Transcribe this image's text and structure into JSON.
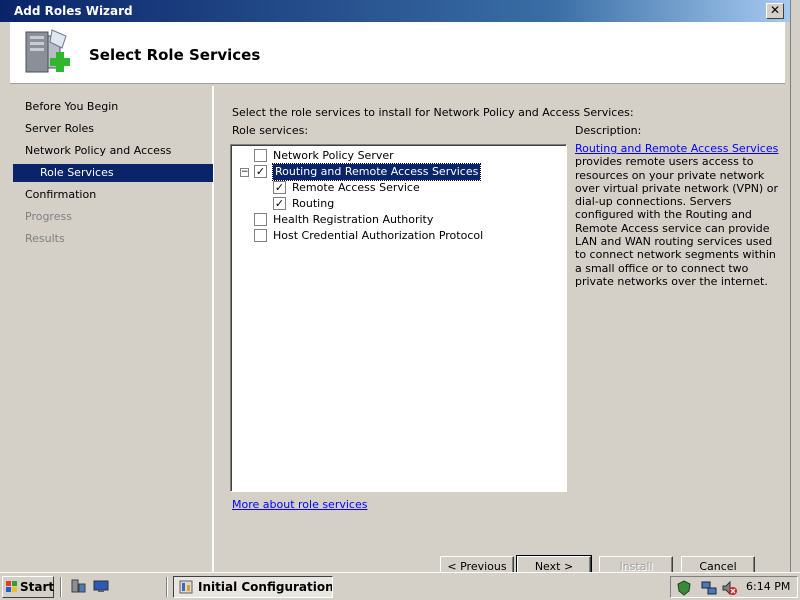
{
  "window": {
    "title": "Add Roles Wizard",
    "close_glyph": "✕",
    "header_title": "Select Role Services"
  },
  "nav": {
    "items": [
      {
        "label": "Before You Begin",
        "state": "normal"
      },
      {
        "label": "Server Roles",
        "state": "normal"
      },
      {
        "label": "Network Policy and Access Services",
        "state": "normal"
      },
      {
        "label": "Role Services",
        "state": "selected"
      },
      {
        "label": "Confirmation",
        "state": "normal"
      },
      {
        "label": "Progress",
        "state": "disabled"
      },
      {
        "label": "Results",
        "state": "disabled"
      }
    ]
  },
  "main": {
    "instruction": "Select the role services to install for Network Policy and Access Services:",
    "role_services_label": "Role services:",
    "description_label": "Description:",
    "description_link": "Routing and Remote Access Services",
    "description_text": "provides remote users access to resources on your private network over virtual private network (VPN) or dial-up connections. Servers configured with the Routing and Remote Access service can provide LAN and WAN routing services used to connect network segments within a small office or to connect two private networks over the internet.",
    "more_link": "More about role services",
    "services": [
      {
        "label": "Network Policy Server",
        "checked": false
      },
      {
        "label": "Routing and Remote Access Services",
        "checked": true,
        "expanded": true,
        "focused": true
      },
      {
        "label": "Remote Access Service",
        "checked": true
      },
      {
        "label": "Routing",
        "checked": true
      },
      {
        "label": "Health Registration Authority",
        "checked": false
      },
      {
        "label": "Host Credential Authorization Protocol",
        "checked": false
      }
    ],
    "expander_glyph": "−",
    "check_glyph": "✓"
  },
  "buttons": {
    "previous": "< Previous",
    "next": "Next >",
    "install": "Install",
    "cancel": "Cancel"
  },
  "taskbar": {
    "start_label": "Start",
    "task_label": "Initial Configuration T...",
    "clock": "6:14 PM"
  }
}
